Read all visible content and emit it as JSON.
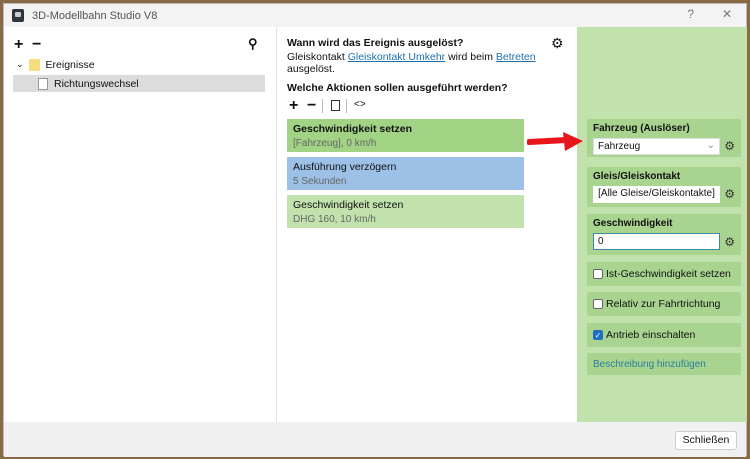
{
  "window": {
    "title": "3D-Modellbahn Studio V8",
    "help": "?",
    "close": "✕"
  },
  "tree": {
    "add": "+",
    "remove": "−",
    "search_icon": "search-icon",
    "root": "Ereignisse",
    "child": "Richtungswechsel"
  },
  "trigger": {
    "heading": "Wann wird das Ereignis ausgelöst?",
    "pre": "Gleiskontakt ",
    "link1": "Gleiskontakt Umkehr",
    "mid": " wird beim ",
    "link2": "Betreten",
    "post": "ausgelöst."
  },
  "actions": {
    "heading": "Welche Aktionen sollen ausgeführt werden?",
    "toolbar": {
      "add": "+",
      "remove": "−",
      "code": "<>"
    },
    "items": [
      {
        "title": "Geschwindigkeit setzen",
        "sub": "[Fahrzeug], 0 km/h",
        "color": "#a2d385",
        "bold": true
      },
      {
        "title": "Ausführung verzögern",
        "sub": "5 Sekunden",
        "color": "#9cc0e6",
        "bold": false
      },
      {
        "title": "Geschwindigkeit setzen",
        "sub": "DHG 160, 10 km/h",
        "color": "#c2e2ad",
        "bold": false
      }
    ]
  },
  "props": {
    "vehicle_label": "Fahrzeug (Auslöser)",
    "vehicle_value": "Fahrzeug",
    "track_label": "Gleis/Gleiskontakt",
    "track_value": "[Alle Gleise/Gleiskontakte]",
    "speed_label": "Geschwindigkeit",
    "speed_value": "0",
    "chk1": {
      "label": "Ist-Geschwindigkeit setzen",
      "checked": false
    },
    "chk2": {
      "label": "Relativ zur Fahrtrichtung",
      "checked": false
    },
    "chk3": {
      "label": "Antrieb einschalten",
      "checked": true
    },
    "desc_link": "Beschreibung hinzufügen"
  },
  "footer": {
    "close": "Schließen"
  },
  "colors": {
    "panel": "#c2e2ad",
    "arrow": "#e8151b",
    "link": "#1e6fa8"
  }
}
